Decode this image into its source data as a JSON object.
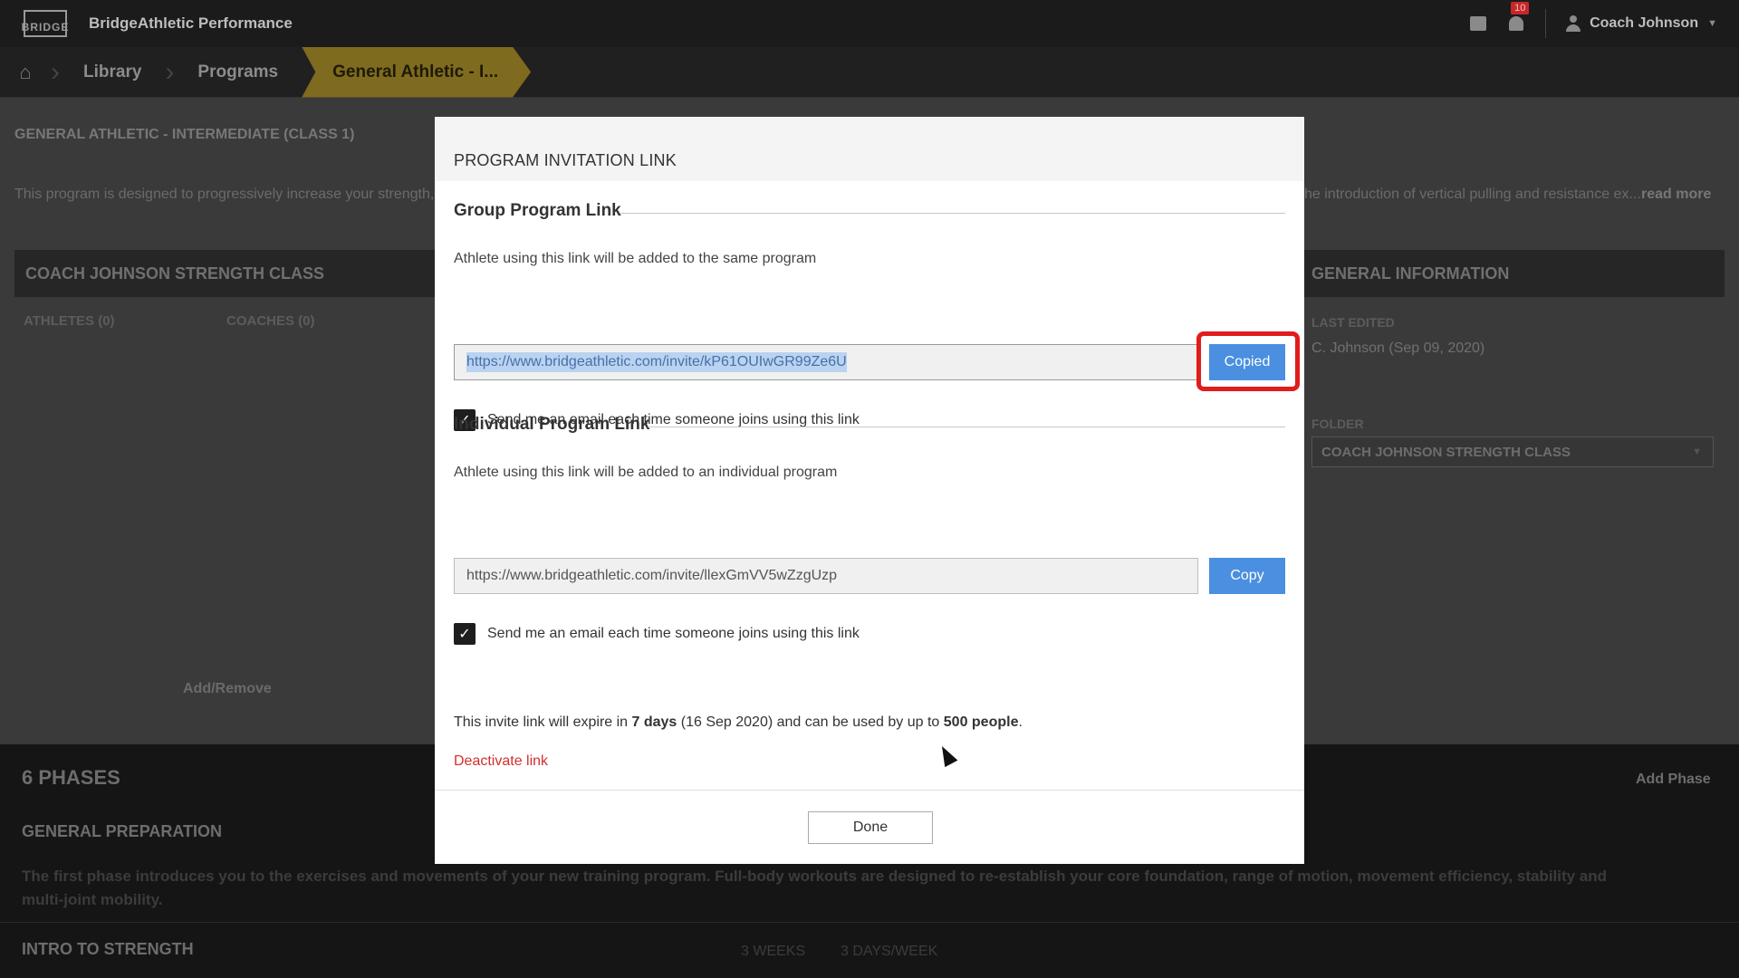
{
  "app": {
    "logo_text": "BRIDGE",
    "title": "BridgeAthletic Performance",
    "notifications_count": "10",
    "user_name": "Coach Johnson"
  },
  "breadcrumb": {
    "items": [
      "Library",
      "Programs"
    ],
    "active": "General Athletic - I..."
  },
  "background": {
    "program_title": "GENERAL ATHLETIC - INTERMEDIATE (CLASS 1)",
    "description_left": "This program is designed to progressively increase your strength, p",
    "description_right": "he introduction of vertical pulling and resistance ex...",
    "read_more": "read more",
    "class_header": "COACH JOHNSON STRENGTH CLASS",
    "athletes_tab": "ATHLETES (0)",
    "coaches_tab": "COACHES (0)",
    "add_remove": "Add/Remove",
    "general_info_header": "GENERAL INFORMATION",
    "last_edited_label": "LAST EDITED",
    "last_edited_value": "C. Johnson (Sep 09, 2020)",
    "folder_label": "FOLDER",
    "folder_value": "COACH JOHNSON STRENGTH CLASS",
    "phases_title": "6 PHASES",
    "add_phase": "Add Phase",
    "phase1_title": "GENERAL PREPARATION",
    "phase1_text_line1": "The first phase introduces you to the exercises and movements of your new training program. Full-body workouts are designed to re-establish your core foundation, range of motion, movement efficiency, stability and",
    "phase1_text_line2": "multi-joint mobility.",
    "phase2_title": "INTRO TO STRENGTH",
    "phase2_weeks": "3 WEEKS",
    "phase2_days": "3 DAYS/WEEK"
  },
  "modal": {
    "title": "PROGRAM INVITATION LINK",
    "group": {
      "title": "Group Program Link",
      "label": "Athlete using this link will be added to the same program",
      "url": "https://www.bridgeathletic.com/invite/kP61OUIwGR99Ze6U",
      "button": "Copied",
      "email_opt": "Send me an email each time someone joins using this link",
      "email_checked": true
    },
    "individual": {
      "title": "Individual Program Link",
      "label": "Athlete using this link will be added to an individual program",
      "url": "https://www.bridgeathletic.com/invite/llexGmVV5wZzgUzp",
      "button": "Copy",
      "email_opt": "Send me an email each time someone joins using this link",
      "email_checked": true
    },
    "expire": {
      "prefix": "This invite link will expire in ",
      "days": "7 days",
      "middle": " (16 Sep 2020) and can be used by up to ",
      "people": "500 people",
      "suffix": "."
    },
    "deactivate": "Deactivate link",
    "done": "Done"
  },
  "colors": {
    "accent_blue": "#4a8fe0",
    "danger_red": "#d32f2f",
    "highlight_red": "#e11c1c",
    "breadcrumb_gold": "#7f6b1f"
  },
  "icons": [
    "home-icon",
    "chat-icon",
    "bell-icon",
    "user-icon",
    "chevron-down-icon",
    "check-icon",
    "cursor-icon"
  ]
}
